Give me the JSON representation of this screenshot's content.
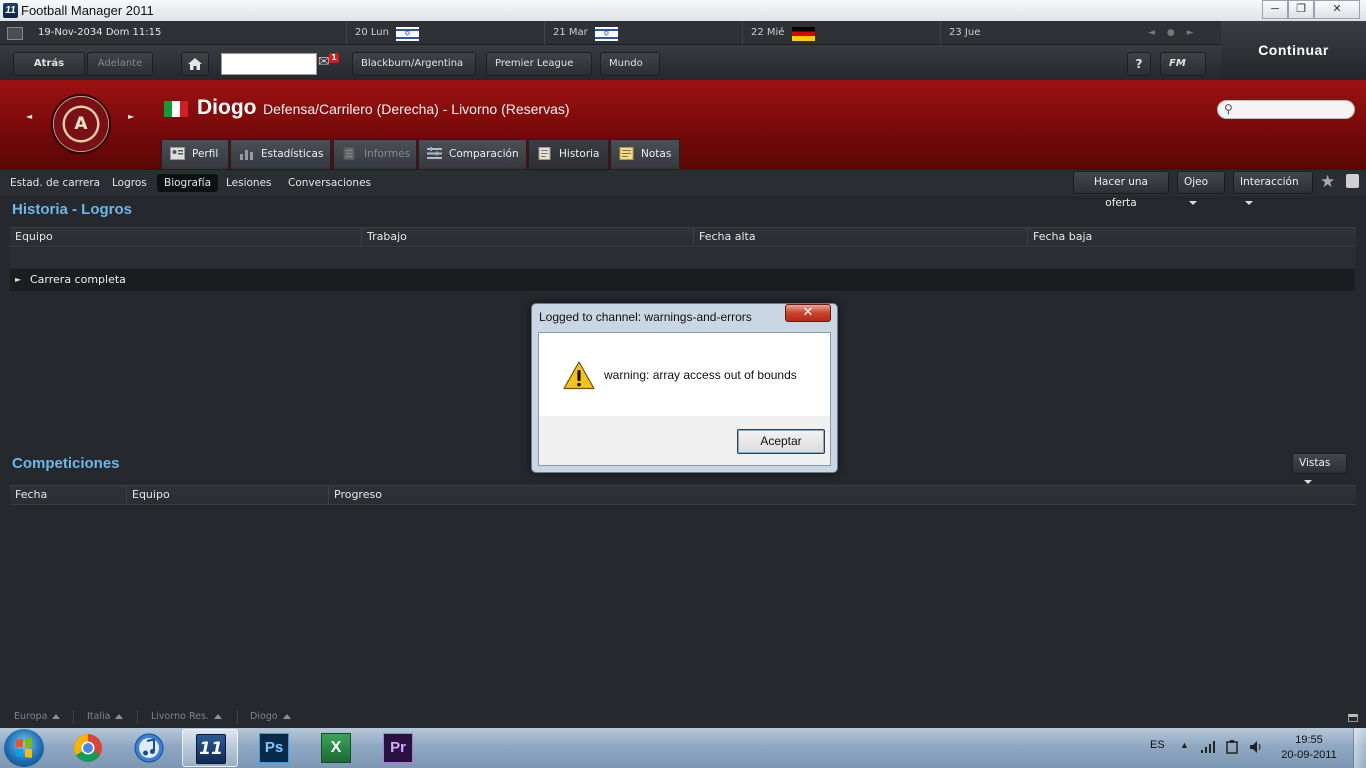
{
  "window": {
    "title": "Football Manager 2011",
    "minimize": "─",
    "maximize": "❐",
    "close": "✕"
  },
  "datebar": {
    "current_date": "19-Nov-2034 Dom 11:15",
    "days": [
      {
        "label": "20 Lun",
        "flag": "israel"
      },
      {
        "label": "21 Mar",
        "flag": "israel"
      },
      {
        "label": "22 Mié",
        "flag": "germany"
      },
      {
        "label": "23 Jue",
        "flag": ""
      }
    ]
  },
  "continue_button": "Continuar",
  "nav": {
    "back": "Atrás",
    "forward": "Adelante",
    "mail_badge": "1",
    "menus": [
      "Blackburn/Argentina",
      "Premier League",
      "Mundo"
    ],
    "help": "?",
    "fm_menu": "FM"
  },
  "player": {
    "name": "Diogo",
    "description": "Defensa/Carrilero (Derecha) - Livorno (Reservas)",
    "nationality_flag": "italy",
    "club_crest_text": "A.S. LIVORNO CALCIO 1915"
  },
  "tabs": [
    {
      "label": "Perfil",
      "icon": "profile-icon"
    },
    {
      "label": "Estadísticas",
      "icon": "stats-icon"
    },
    {
      "label": "Informes",
      "icon": "report-icon"
    },
    {
      "label": "Comparación",
      "icon": "compare-icon"
    },
    {
      "label": "Historia",
      "icon": "history-icon"
    },
    {
      "label": "Notas",
      "icon": "notes-icon"
    }
  ],
  "subnav": [
    "Estad. de carrera",
    "Logros",
    "Biografía",
    "Lesiones",
    "Conversaciones"
  ],
  "actions": {
    "offer": "Hacer una oferta",
    "scout": "Ojeo",
    "interaction": "Interacción"
  },
  "history": {
    "title": "Historia - Logros",
    "columns": [
      "Equipo",
      "Trabajo",
      "Fecha alta",
      "Fecha baja"
    ],
    "group": "Carrera completa"
  },
  "competitions": {
    "title": "Competiciones",
    "views": "Vistas",
    "columns": [
      "Fecha",
      "Equipo",
      "Progreso"
    ]
  },
  "breadcrumbs": [
    "Europa",
    "Italia",
    "Livorno Res.",
    "Diogo"
  ],
  "dialog": {
    "title": "Logged to channel: warnings-and-errors",
    "close": "✕",
    "message": "warning: array access out of bounds",
    "ok": "Aceptar"
  },
  "taskbar": {
    "apps": [
      "Chrome",
      "iTunes",
      "Football Manager 2011",
      "Photoshop",
      "Excel",
      "Premiere"
    ],
    "language": "ES",
    "time": "19:55",
    "date": "20-09-2011"
  }
}
